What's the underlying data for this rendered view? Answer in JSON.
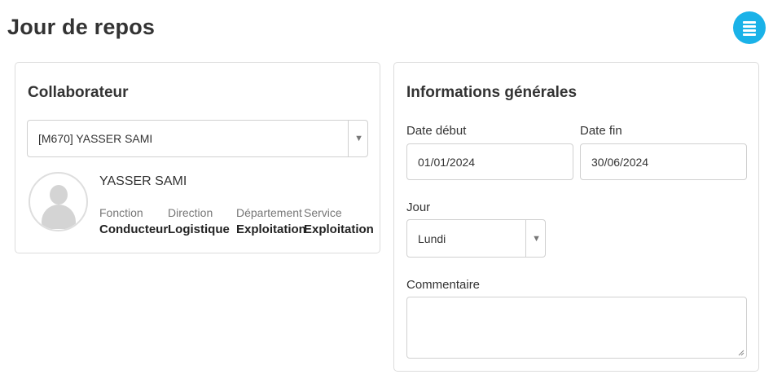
{
  "page": {
    "title": "Jour de repos"
  },
  "header": {
    "menu_icon": "list-menu-icon",
    "menu_color": "#1ab2e8"
  },
  "collaborateur": {
    "title": "Collaborateur",
    "select_value": "[M670] YASSER SAMI",
    "name": "YASSER SAMI",
    "details": [
      {
        "label": "Fonction",
        "value": "Conducteur"
      },
      {
        "label": "Direction",
        "value": "Logistique"
      },
      {
        "label": "Département",
        "value": "Exploitation"
      },
      {
        "label": "Service",
        "value": "Exploitation"
      }
    ]
  },
  "informations": {
    "title": "Informations générales",
    "date_debut_label": "Date début",
    "date_debut_value": "01/01/2024",
    "date_fin_label": "Date fin",
    "date_fin_value": "30/06/2024",
    "jour_label": "Jour",
    "jour_value": "Lundi",
    "commentaire_label": "Commentaire",
    "commentaire_value": ""
  }
}
